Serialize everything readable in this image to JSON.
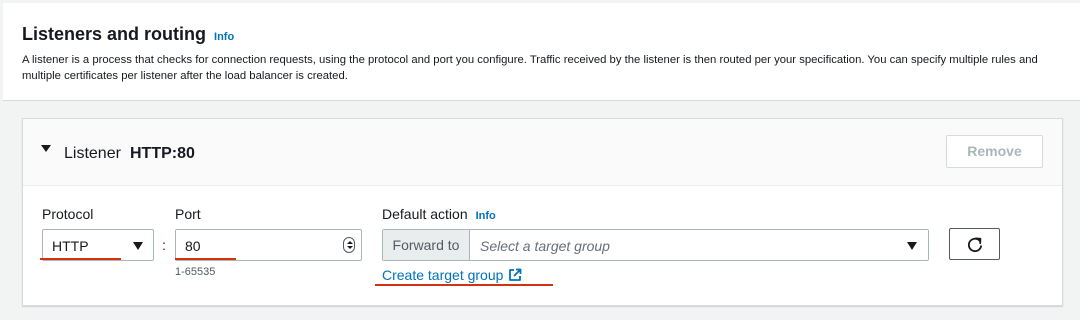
{
  "header": {
    "title": "Listeners and routing",
    "info_label": "Info",
    "description": "A listener is a process that checks for connection requests, using the protocol and port you configure. Traffic received by the listener is then routed per your specification. You can specify multiple rules and multiple certificates per listener after the load balancer is created."
  },
  "listener": {
    "label": "Listener",
    "value": "HTTP:80",
    "remove_label": "Remove",
    "protocol": {
      "label": "Protocol",
      "selected": "HTTP"
    },
    "separator": ":",
    "port": {
      "label": "Port",
      "value": "80",
      "hint": "1-65535"
    },
    "default_action": {
      "label": "Default action",
      "info_label": "Info",
      "addon": "Forward to",
      "placeholder": "Select a target group",
      "create_link": "Create target group"
    }
  },
  "icons": {
    "caret": "caret-down-icon",
    "dropdown": "triangle-down-icon",
    "refresh": "refresh-icon",
    "external": "external-link-icon",
    "spinner": "number-spinner-icon"
  },
  "colors": {
    "link": "#0073bb",
    "annotation": "#d13212",
    "disabled": "#aab7b8"
  }
}
